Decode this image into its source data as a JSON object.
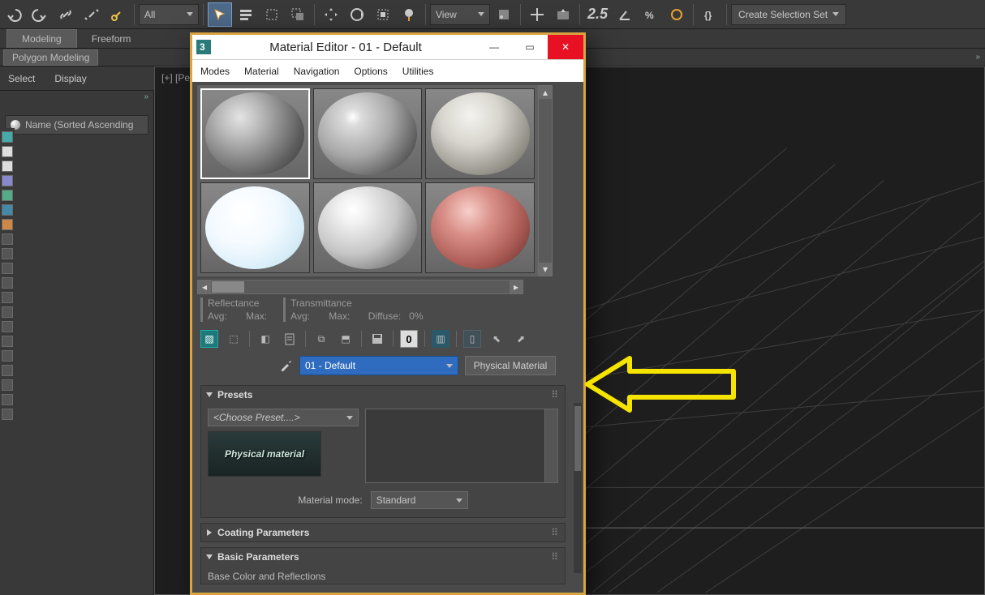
{
  "toolbar": {
    "filter_dd": "All",
    "view_dd": "View",
    "angle_num": "2.5",
    "create_set": "Create Selection Set"
  },
  "ribbon": {
    "tabs": [
      "Modeling",
      "Freeform"
    ],
    "sub": "Polygon Modeling"
  },
  "cmd": {
    "select": "Select",
    "display": "Display"
  },
  "scene": {
    "header": "Name (Sorted Ascending"
  },
  "viewport": {
    "label": "[+] [Pers"
  },
  "mat": {
    "title": "Material Editor - 01 - Default",
    "menu": [
      "Modes",
      "Material",
      "Navigation",
      "Options",
      "Utilities"
    ],
    "info": {
      "refl": "Reflectance",
      "refl_avg": "Avg:",
      "refl_max": "Max:",
      "trans": "Transmittance",
      "trans_avg": "Avg:",
      "trans_max": "Max:",
      "diffuse": "Diffuse:",
      "diffuse_val": "0%"
    },
    "tool_zero": "0",
    "name_dd": "01 - Default",
    "type_btn": "Physical Material",
    "presets": {
      "title": "Presets",
      "choose": "<Choose Preset....>",
      "thumb_text": "Physical material",
      "mode_label": "Material mode:",
      "mode_value": "Standard"
    },
    "coating": "Coating Parameters",
    "basic": "Basic Parameters",
    "basic_sub": "Base Color and Reflections"
  }
}
